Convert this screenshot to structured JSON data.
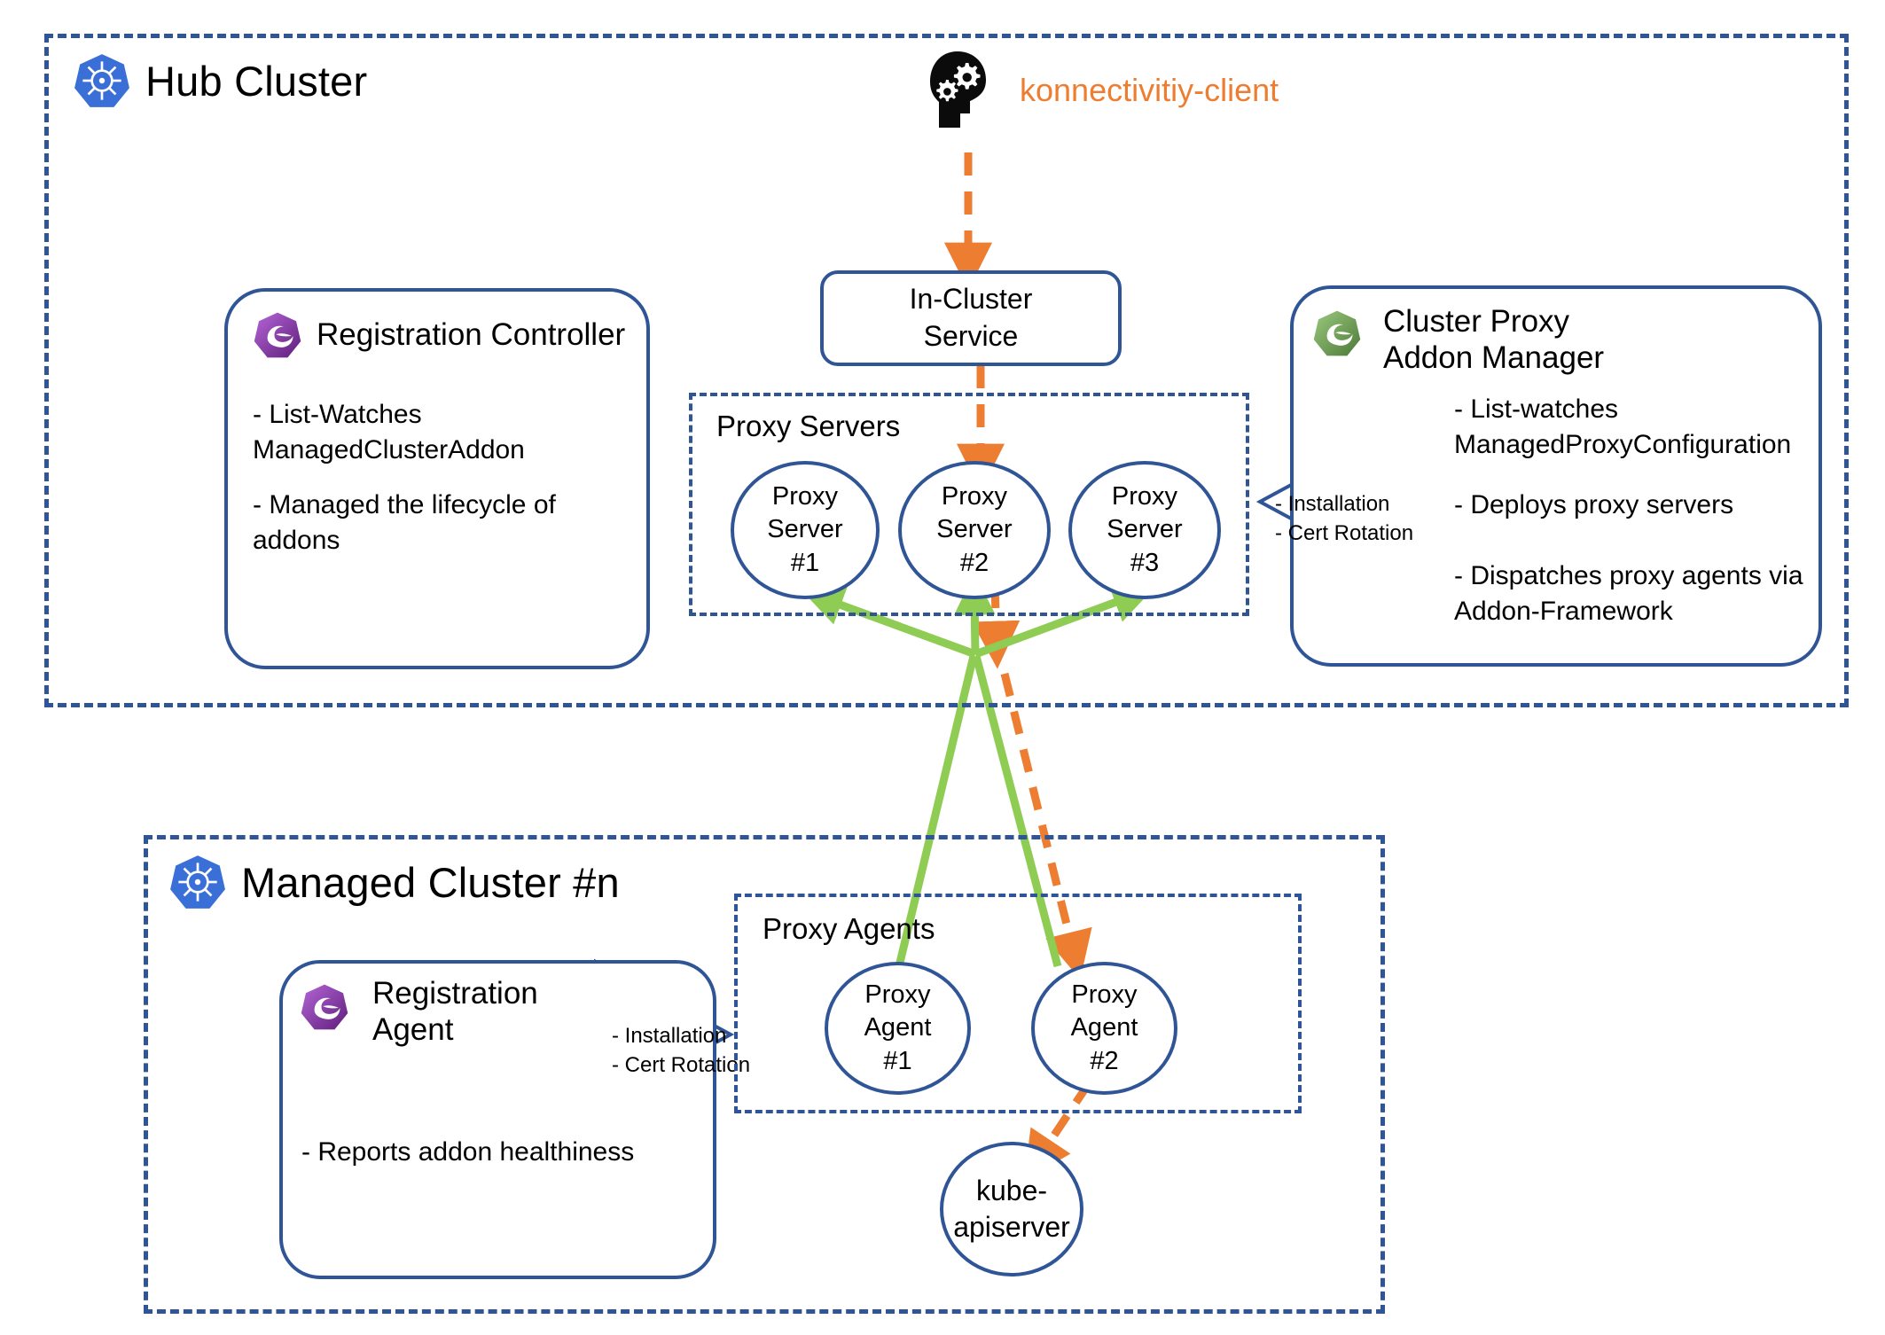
{
  "diagram": {
    "title": "Cluster Proxy Addon Architecture",
    "colors": {
      "cluster_border": "#2F5597",
      "box_border": "#2F5597",
      "connector_green": "#8ECC54",
      "connector_orange": "#ED7D31",
      "k8s_blue": "#3A6FD8",
      "ocm_purple": "#8E3FA8",
      "ocm_green": "#6A9E52",
      "text_black": "#000000"
    }
  },
  "hub_cluster": {
    "title": "Hub Cluster",
    "icon": "kubernetes-icon"
  },
  "konnectivity_client": {
    "label": "konnectivitiy-client",
    "icon": "head-with-gears-icon"
  },
  "in_cluster_service": {
    "line1": "In-Cluster",
    "line2": "Service"
  },
  "registration_controller": {
    "icon": "ocm-purple-icon",
    "title": "Registration Controller",
    "bullets": [
      "- List-Watches\nManagedClusterAddon",
      "- Managed the lifecycle of\naddons"
    ]
  },
  "cluster_proxy_addon_manager": {
    "icon": "ocm-green-icon",
    "title_line1": "Cluster Proxy",
    "title_line2": "Addon Manager",
    "bullets": [
      "- List-watches\nManagedProxyConfiguration",
      "- Deploys proxy servers",
      "- Dispatches proxy agents via\nAddon-Framework"
    ]
  },
  "proxy_servers_group": {
    "title": "Proxy Servers",
    "nodes": [
      {
        "line1": "Proxy",
        "line2": "Server",
        "line3": "#1"
      },
      {
        "line1": "Proxy",
        "line2": "Server",
        "line3": "#2"
      },
      {
        "line1": "Proxy",
        "line2": "Server",
        "line3": "#3"
      }
    ]
  },
  "hub_callout": {
    "line1": "- Installation",
    "line2": "- Cert Rotation"
  },
  "managed_cluster": {
    "title": "Managed Cluster #n",
    "icon": "kubernetes-icon"
  },
  "registration_agent": {
    "icon": "ocm-purple-icon",
    "title_line1": "Registration",
    "title_line2": "Agent",
    "bullets": [
      "- Reports addon healthiness"
    ]
  },
  "managed_callout": {
    "line1": "- Installation",
    "line2": "- Cert Rotation"
  },
  "proxy_agents_group": {
    "title": "Proxy Agents",
    "nodes": [
      {
        "line1": "Proxy",
        "line2": "Agent",
        "line3": "#1"
      },
      {
        "line1": "Proxy",
        "line2": "Agent",
        "line3": "#2"
      }
    ]
  },
  "kube_apiserver": {
    "line1": "kube-",
    "line2": "apiserver"
  }
}
